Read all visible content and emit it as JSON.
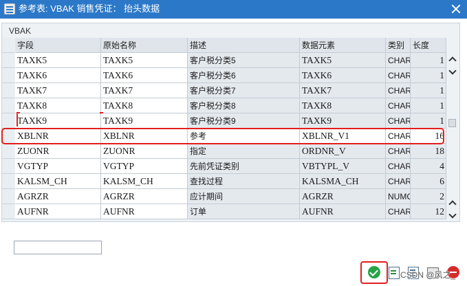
{
  "window": {
    "title": "参考表: VBAK 销售凭证： 抬头数据",
    "icon": "table-icon",
    "close_icon": "close-icon"
  },
  "panel": {
    "title": "VBAK"
  },
  "table": {
    "columns": [
      "字段",
      "原始名称",
      "描述",
      "数据元素",
      "类别",
      "长度"
    ],
    "rows": [
      {
        "field": "TAXK5",
        "orig": "TAXK5",
        "desc": "客户税分类5",
        "element": "TAXK5",
        "type": "CHAR",
        "len": "1"
      },
      {
        "field": "TAXK6",
        "orig": "TAXK6",
        "desc": "客户税分类6",
        "element": "TAXK6",
        "type": "CHAR",
        "len": "1"
      },
      {
        "field": "TAXK7",
        "orig": "TAXK7",
        "desc": "客户税分类7",
        "element": "TAXK7",
        "type": "CHAR",
        "len": "1"
      },
      {
        "field": "TAXK8",
        "orig": "TAXK8",
        "desc": "客户税分类8",
        "element": "TAXK8",
        "type": "CHAR",
        "len": "1"
      },
      {
        "field": "TAXK9",
        "orig": "TAXK9",
        "desc": "客户税分类9",
        "element": "TAXK9",
        "type": "CHAR",
        "len": "1"
      },
      {
        "field": "XBLNR",
        "orig": "XBLNR",
        "desc": "参考",
        "element": "XBLNR_V1",
        "type": "CHAR",
        "len": "16"
      },
      {
        "field": "ZUONR",
        "orig": "ZUONR",
        "desc": "指定",
        "element": "ORDNR_V",
        "type": "CHAR",
        "len": "18"
      },
      {
        "field": "VGTYP",
        "orig": "VGTYP",
        "desc": "先前凭证类别",
        "element": "VBTYPL_V",
        "type": "CHAR",
        "len": "4"
      },
      {
        "field": "KALSM_CH",
        "orig": "KALSM_CH",
        "desc": "查找过程",
        "element": "KALSMA_CH",
        "type": "CHAR",
        "len": "6"
      },
      {
        "field": "AGRZR",
        "orig": "AGRZR",
        "desc": "应计期间",
        "element": "AGRZR",
        "type": "NUMC",
        "len": "2"
      },
      {
        "field": "AUFNR",
        "orig": "AUFNR",
        "desc": "订单",
        "element": "AUFNR",
        "type": "CHAR",
        "len": "12"
      }
    ]
  },
  "footer": {
    "input_value": "",
    "watermark": "CSDN @风之_"
  },
  "toolbar": {
    "confirm_icon": "check-icon",
    "colors": {
      "accent": "#2c78c8",
      "highlight": "#e21d1d",
      "confirm": "#27a347"
    }
  }
}
